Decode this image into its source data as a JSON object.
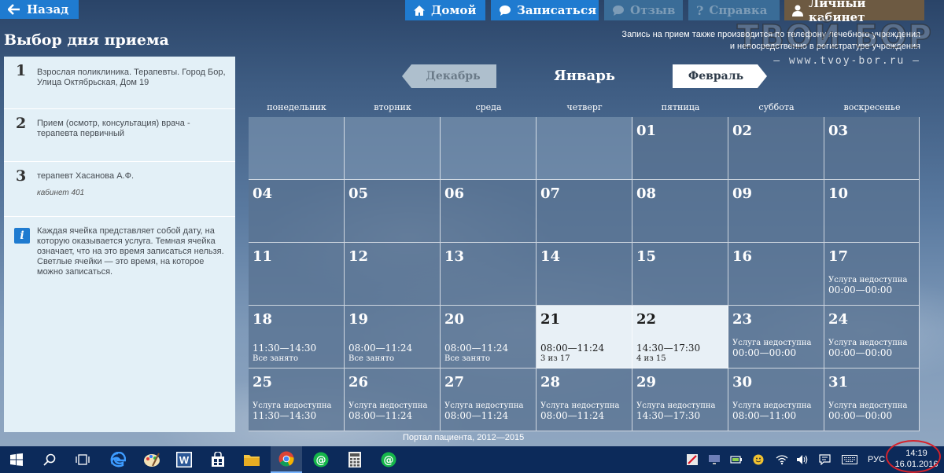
{
  "header": {
    "back_label": "Назад",
    "nav": [
      {
        "label": "Домой"
      },
      {
        "label": "Записаться"
      },
      {
        "label": "Отзыв"
      },
      {
        "label": "Справка"
      },
      {
        "label": "Личный кабинет"
      }
    ],
    "page_title": "Выбор дня приема",
    "note_line1": "Запись на прием также производится по телефону лечебного учреждения",
    "note_line2": "и непосредственно в регистратуре учреждения",
    "watermark": "ТВОЙ БОР",
    "watermark_sub": "— www.tvoy-bor.ru —"
  },
  "steps": [
    {
      "num": "1",
      "text": "Взрослая поликлиника. Терапевты. Город Бор, Улица Октябрьская, Дом 19"
    },
    {
      "num": "2",
      "text": "Прием (осмотр, консультация) врача - терапевта первичный"
    },
    {
      "num": "3",
      "text": "терапевт Хасанова А.Ф.",
      "sub": "кабинет 401"
    }
  ],
  "info": {
    "icon": "info-icon",
    "text": "Каждая ячейка представляет собой дату, на которую оказывается услуга. Темная ячейка означает, что на это время записаться нельзя. Светлые ячейки — это время, на которое можно записаться."
  },
  "calendar": {
    "prev_month": "Декабрь",
    "current_month": "Январь",
    "next_month": "Февраль",
    "weekdays": [
      "понедельник",
      "вторник",
      "среда",
      "четверг",
      "пятница",
      "суббота",
      "воскресенье"
    ],
    "days": [
      {
        "day": "",
        "empty": true
      },
      {
        "day": "",
        "empty": true
      },
      {
        "day": "",
        "empty": true
      },
      {
        "day": "",
        "empty": true
      },
      {
        "day": "01"
      },
      {
        "day": "02"
      },
      {
        "day": "03"
      },
      {
        "day": "04"
      },
      {
        "day": "05"
      },
      {
        "day": "06"
      },
      {
        "day": "07"
      },
      {
        "day": "08"
      },
      {
        "day": "09"
      },
      {
        "day": "10"
      },
      {
        "day": "11"
      },
      {
        "day": "12"
      },
      {
        "day": "13"
      },
      {
        "day": "14"
      },
      {
        "day": "15"
      },
      {
        "day": "16"
      },
      {
        "day": "17",
        "status": "Услуга недоступна",
        "time": "00:00—00:00"
      },
      {
        "day": "18",
        "time": "11:30—14:30",
        "sub": "Все занято"
      },
      {
        "day": "19",
        "time": "08:00—11:24",
        "sub": "Все занято"
      },
      {
        "day": "20",
        "time": "08:00—11:24",
        "sub": "Все занято"
      },
      {
        "day": "21",
        "time": "08:00—11:24",
        "sub": "3 из 17",
        "available": true
      },
      {
        "day": "22",
        "time": "14:30—17:30",
        "sub": "4 из 15",
        "available": true
      },
      {
        "day": "23",
        "status": "Услуга недоступна",
        "time": "00:00—00:00"
      },
      {
        "day": "24",
        "status": "Услуга недоступна",
        "time": "00:00—00:00"
      },
      {
        "day": "25",
        "status": "Услуга недоступна",
        "time": "11:30—14:30"
      },
      {
        "day": "26",
        "status": "Услуга недоступна",
        "time": "08:00—11:24"
      },
      {
        "day": "27",
        "status": "Услуга недоступна",
        "time": "08:00—11:24"
      },
      {
        "day": "28",
        "status": "Услуга недоступна",
        "time": "08:00—11:24"
      },
      {
        "day": "29",
        "status": "Услуга недоступна",
        "time": "14:30—17:30"
      },
      {
        "day": "30",
        "status": "Услуга недоступна",
        "time": "08:00—11:00"
      },
      {
        "day": "31",
        "status": "Услуга недоступна",
        "time": "00:00—00:00"
      }
    ]
  },
  "footer": "Портал пациента, 2012—2015",
  "taskbar": {
    "apps": [
      "windows-start-icon",
      "search-icon",
      "task-view-icon",
      "edge-icon",
      "paint-icon",
      "word-icon",
      "store-icon",
      "file-explorer-icon",
      "chrome-icon",
      "mail-agent-icon",
      "calculator-icon",
      "mail-agent-icon"
    ],
    "language": "РУС",
    "time": "14:19",
    "date": "16.01.2016"
  },
  "colors": {
    "primary_button": "#1f7bd0",
    "cabinet_button": "#6d5a42",
    "available_cell": "#e8f0f6",
    "taskbar": "#0c2a5a",
    "highlight_circle": "#d5222b"
  }
}
